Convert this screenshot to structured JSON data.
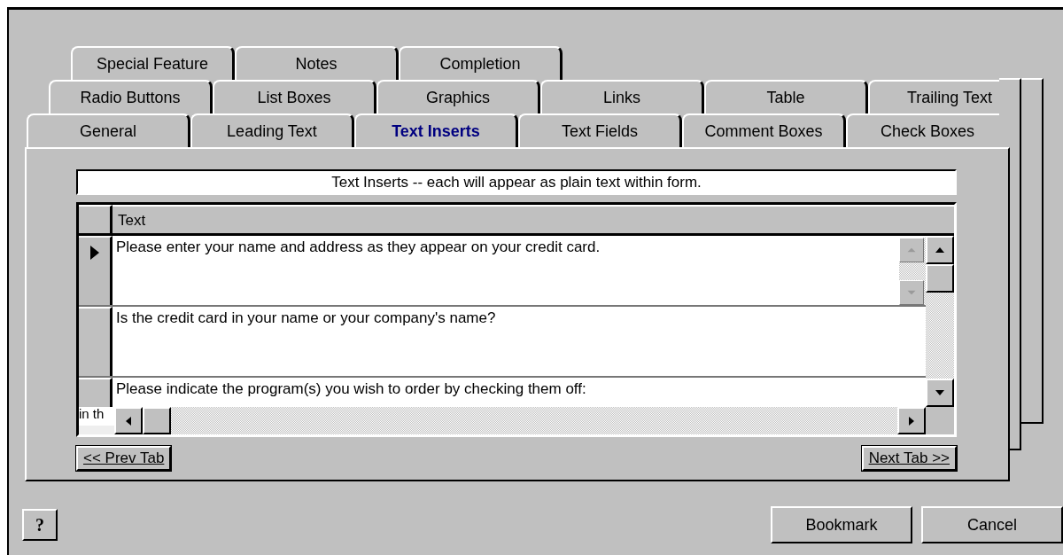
{
  "tabs": {
    "rows": [
      [
        {
          "label": "Special Feature",
          "selected": false
        },
        {
          "label": "Notes",
          "selected": false
        },
        {
          "label": "Completion",
          "selected": false
        }
      ],
      [
        {
          "label": "Radio Buttons",
          "selected": false
        },
        {
          "label": "List Boxes",
          "selected": false
        },
        {
          "label": "Graphics",
          "selected": false
        },
        {
          "label": "Links",
          "selected": false
        },
        {
          "label": "Table",
          "selected": false
        },
        {
          "label": "Trailing Text",
          "selected": false
        }
      ],
      [
        {
          "label": "General",
          "selected": false
        },
        {
          "label": "Leading Text",
          "selected": false
        },
        {
          "label": "Text Inserts",
          "selected": true
        },
        {
          "label": "Text Fields",
          "selected": false
        },
        {
          "label": "Comment Boxes",
          "selected": false
        },
        {
          "label": "Check Boxes",
          "selected": false
        }
      ]
    ]
  },
  "section_title": "Text Inserts -- each will appear as plain text within form.",
  "table": {
    "columns": [
      "Text"
    ],
    "rows": [
      {
        "text": "Please enter your name and address as they appear on your credit card.",
        "selected": true
      },
      {
        "text": "Is the credit card in your name or your company's name?",
        "selected": false
      },
      {
        "text": "Please indicate the program(s) you wish to order by checking them off:",
        "selected": false
      }
    ],
    "cut_cell": "in th"
  },
  "nav_buttons": {
    "prev": "<< Prev Tab",
    "next": "Next Tab >>"
  },
  "footer": {
    "help": "?",
    "buttons": [
      "Bookmark",
      "Cancel"
    ]
  }
}
